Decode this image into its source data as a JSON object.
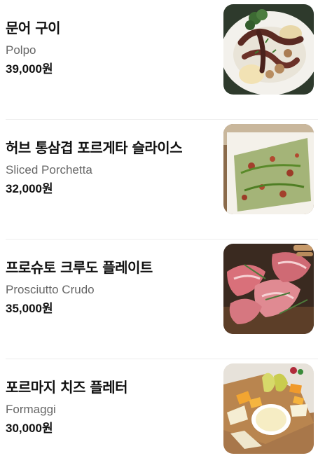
{
  "menu": {
    "items": [
      {
        "name_ko": "문어 구이",
        "name_en": "Polpo",
        "price": "39,000원"
      },
      {
        "name_ko": "허브 통삼겹 포르게타 슬라이스",
        "name_en": "Sliced Porchetta",
        "price": "32,000원"
      },
      {
        "name_ko": "프로슈토 크루도 플레이트",
        "name_en": "Prosciutto Crudo",
        "price": "35,000원"
      },
      {
        "name_ko": "포르마지 치즈 플레터",
        "name_en": "Formaggi",
        "price": "30,000원"
      }
    ]
  }
}
